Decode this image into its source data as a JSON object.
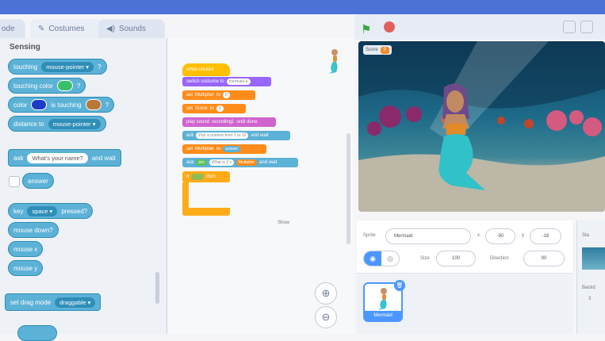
{
  "tabs": {
    "code": "ode",
    "costumes": "Costumes",
    "sounds": "Sounds"
  },
  "palette": {
    "category": "Sensing",
    "touching": {
      "label": "touching",
      "value": "mouse-pointer",
      "q": "?"
    },
    "touching_color": {
      "label": "touching color",
      "q": "?",
      "color": "#39c06b"
    },
    "color_touching": {
      "label1": "color",
      "label2": "is touching",
      "q": "?",
      "color1": "#1f3cc7",
      "color2": "#b7793a"
    },
    "distance": {
      "label": "distance to",
      "value": "mouse-pointer"
    },
    "ask": {
      "label": "ask",
      "value": "What's your name?",
      "label2": "and wait"
    },
    "answer": "answer",
    "key": {
      "label": "key",
      "value": "space",
      "label2": "pressed?"
    },
    "mouse_down": "mouse down?",
    "mouse_x": "mouse x",
    "mouse_y": "mouse y",
    "drag": {
      "label": "set drag mode",
      "value": "draggable"
    }
  },
  "script": {
    "hat": "when clicked",
    "l1": {
      "label": "switch costume to",
      "value": "mermaid-a"
    },
    "l2": {
      "label": "set",
      "var": "Multiplier",
      "label2": "to",
      "value": "0"
    },
    "l3": {
      "label": "set",
      "var": "Score",
      "label2": "to",
      "value": "0"
    },
    "l4": {
      "label": "play sound",
      "value": "recording1",
      "label2": "until done"
    },
    "l5": {
      "label": "ask",
      "value": "Pick a number from 1 to 10",
      "label2": "and wait"
    },
    "l6": {
      "label": "set",
      "var": "Multiplier",
      "label2": "to",
      "value": "answer"
    },
    "l7": {
      "label": "ask",
      "value": "join",
      "v2": "What is 2 x",
      "v3": "Multiplier",
      "label2": "and wait"
    },
    "l8": {
      "label": "if",
      "label2": "then"
    }
  },
  "stage": {
    "score_label": "Score",
    "score_value": "0"
  },
  "sprite": {
    "sprite_label": "Sprite",
    "name": "Mermaid",
    "x_label": "x",
    "x": "-90",
    "y_label": "y",
    "y": "-18",
    "show_label": "Show",
    "size_label": "Size",
    "size": "100",
    "direction_label": "Direction",
    "direction": "90",
    "thumb_label": "Mermaid"
  },
  "stage_pane": {
    "title": "Sta",
    "backdrops": "Backd",
    "count": "3"
  },
  "colors": {
    "accent": "#4c97ff",
    "sensing": "#5cb1d6",
    "flag": "#3aa845",
    "stop": "#e0605e"
  }
}
